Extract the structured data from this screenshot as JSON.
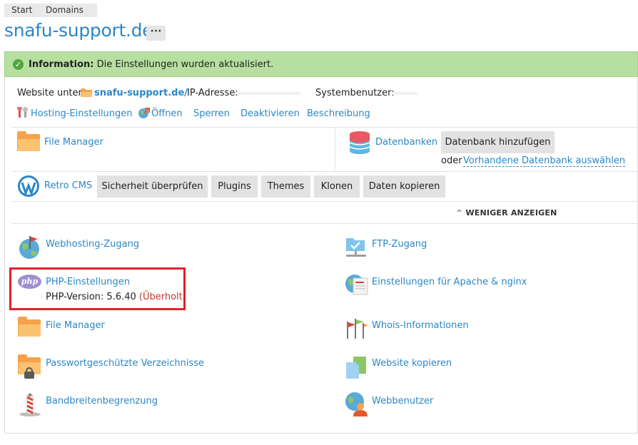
{
  "breadcrumb": [
    "Start",
    "Domains"
  ],
  "page_title": "snafu-support.de",
  "more_button": "···",
  "info_message": {
    "prefix": "Information:",
    "text": "Die Einstellungen wurden aktualisiert."
  },
  "website_line": {
    "label": "Website unter",
    "domain_link": "snafu-support.de/",
    "ip_label": "IP-Adresse:",
    "sysuser_label": "Systembenutzer:"
  },
  "actions": [
    "Hosting-Einstellungen",
    "Öffnen",
    "Sperren",
    "Deaktivieren",
    "Beschreibung"
  ],
  "file_manager_top": "File Manager",
  "databases": {
    "label": "Datenbanken",
    "add_button": "Datenbank hinzufügen",
    "or_text": "oder",
    "select_link": "Vorhandene Datenbank auswählen"
  },
  "cms": {
    "label": "Retro CMS",
    "buttons": [
      "Sicherheit überprüfen",
      "Plugins",
      "Themes",
      "Klonen",
      "Daten kopieren"
    ]
  },
  "show_less": "WENIGER ANZEIGEN",
  "tools_left": [
    {
      "label": "Webhosting-Zugang",
      "icon": "globe-flag-icon"
    },
    {
      "label": "PHP-Einstellungen",
      "icon": "php-icon",
      "sub": "PHP-Version: 5.6.40",
      "sub_warn": "(Überholt)"
    },
    {
      "label": "File Manager",
      "icon": "folder-icon"
    },
    {
      "label": "Passwortgeschützte Verzeichnisse",
      "icon": "locked-folder-icon"
    },
    {
      "label": "Bandbreitenbegrenzung",
      "icon": "bandwidth-icon"
    }
  ],
  "tools_right": [
    {
      "label": "FTP-Zugang",
      "icon": "ftp-icon"
    },
    {
      "label": "Einstellungen für Apache & nginx",
      "icon": "server-globe-icon"
    },
    {
      "label": "Whois-Informationen",
      "icon": "whois-flags-icon"
    },
    {
      "label": "Website kopieren",
      "icon": "copy-pages-icon"
    },
    {
      "label": "Webbenutzer",
      "icon": "web-user-icon"
    }
  ],
  "colors": {
    "link": "#2b87c7",
    "info_bg": "#b7dfa0",
    "warn": "#c0362c",
    "highlight": "#e0212a",
    "folder": "#f6a24a"
  }
}
